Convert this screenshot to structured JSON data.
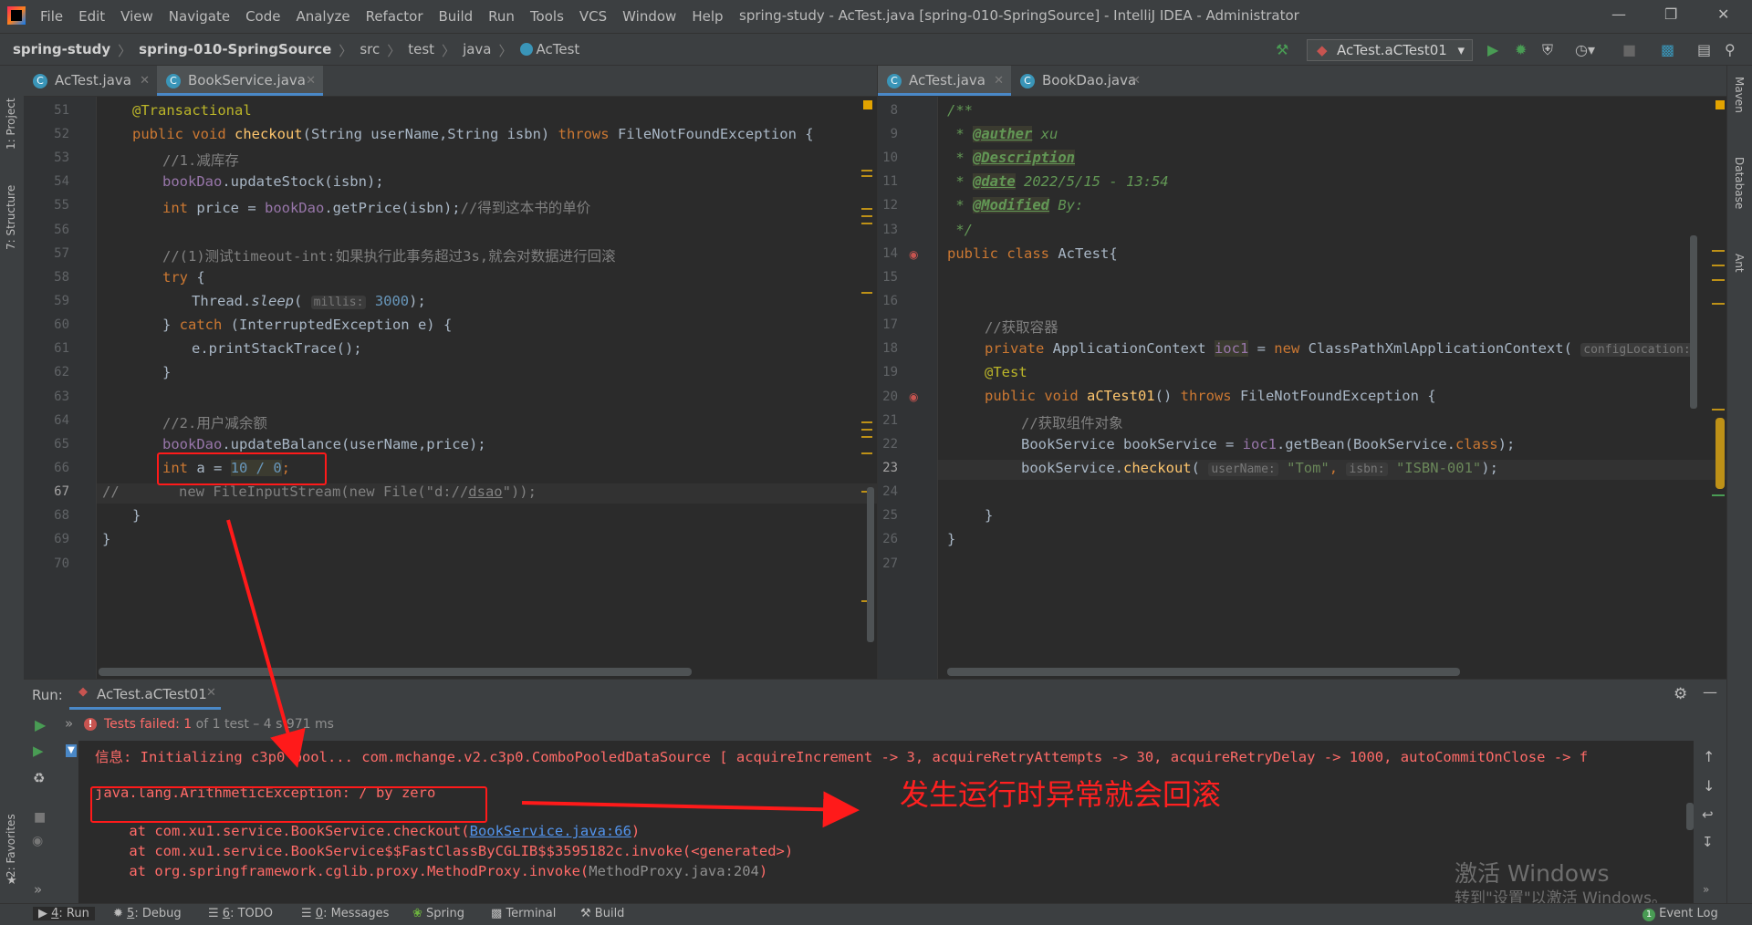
{
  "window": {
    "title": "spring-study - AcTest.java [spring-010-SpringSource] - IntelliJ IDEA - Administrator",
    "menu": [
      "File",
      "Edit",
      "View",
      "Navigate",
      "Code",
      "Analyze",
      "Refactor",
      "Build",
      "Run",
      "Tools",
      "VCS",
      "Window",
      "Help"
    ]
  },
  "breadcrumb": {
    "project": "spring-study",
    "module": "spring-010-SpringSource",
    "src": "src",
    "test": "test",
    "java": "java",
    "cls": "AcTest"
  },
  "run_config": "AcTest.aCTest01",
  "left_strip": {
    "project": "1: Project",
    "structure": "7: Structure",
    "favorites": "2: Favorites"
  },
  "right_strip": {
    "maven": "Maven",
    "database": "Database",
    "ant": "Ant"
  },
  "left_tabs": [
    {
      "label": "AcTest.java",
      "active": false
    },
    {
      "label": "BookService.java",
      "active": true
    }
  ],
  "right_tabs": [
    {
      "label": "AcTest.java",
      "active": true
    },
    {
      "label": "BookDao.java",
      "active": false
    }
  ],
  "left_lines": [
    "51",
    "52",
    "53",
    "54",
    "55",
    "56",
    "57",
    "58",
    "59",
    "60",
    "61",
    "62",
    "63",
    "64",
    "65",
    "66",
    "67",
    "68",
    "69",
    "70"
  ],
  "right_lines": [
    "8",
    "9",
    "10",
    "11",
    "12",
    "13",
    "14",
    "15",
    "16",
    "17",
    "18",
    "19",
    "20",
    "21",
    "22",
    "23",
    "24",
    "25",
    "26",
    "27"
  ],
  "left_code": {
    "l51": "@Transactional",
    "l52a": "public void ",
    "l52b": "checkout",
    "l52c": "(String userName,String isbn) ",
    "l52d": "throws ",
    "l52e": "FileNotFoundException {",
    "l53": "//1.减库存",
    "l54a": "bookDao",
    "l54b": ".updateStock(isbn);",
    "l55a": "int ",
    "l55b": "price = ",
    "l55c": "bookDao",
    "l55d": ".getPrice(isbn);",
    "l55e": "//得到这本书的单价",
    "l57": "//(1)测试timeout-int:如果执行此事务超过3s,就会对数据进行回滚",
    "l58a": "try ",
    "l58b": "{",
    "l59a": "Thread.",
    "l59b": "sleep",
    "l59c": "( ",
    "l59h": "millis:",
    "l59d": "3000",
    "l59e": ");",
    "l60a": "} ",
    "l60b": "catch ",
    "l60c": "(InterruptedException e) {",
    "l61": "e.printStackTrace();",
    "l62": "}",
    "l64": "//2.用户减余额",
    "l65a": "bookDao",
    "l65b": ".updateBalance(userName,price);",
    "l66a": "int ",
    "l66b": "a = ",
    "l66c": "10 / 0",
    "l66d": ";",
    "l67a": "//",
    "l67b": "new FileInputStream(new File(\"d://",
    "l67c": "dsao",
    "l67d": "\"));",
    "l68": "}",
    "l69": "}"
  },
  "right_code": {
    "l8": "/**",
    "l9a": " * ",
    "l9b": "@auther",
    "l9c": " xu",
    "l10a": " * ",
    "l10b": "@Description",
    "l11a": " * ",
    "l11b": "@date",
    "l11c": " 2022/5/15 - 13:54",
    "l12a": " * ",
    "l12b": "@Modified",
    "l12c": " By:",
    "l13": " */",
    "l14a": "public class ",
    "l14b": "AcTest{",
    "l17": "//获取容器",
    "l18a": "private ",
    "l18b": "ApplicationContext ",
    "l18c": "ioc1",
    "l18d": " = ",
    "l18e": "new ",
    "l18f": "ClassPathXmlApplicationContext(",
    "l18g": "configLocation:",
    "l19": "@Test",
    "l20a": "public void ",
    "l20b": "aCTest01",
    "l20c": "() ",
    "l20d": "throws ",
    "l20e": "FileNotFoundException {",
    "l21": "//获取组件对象",
    "l22a": "BookService bookService = ",
    "l22b": "ioc1",
    "l22c": ".getBean(BookService.",
    "l22d": "class",
    "l22e": ");",
    "l23a": "bookService.",
    "l23b": "checkout",
    "l23c": "( ",
    "l23h1": "userName:",
    "l23d": "\"Tom\"",
    "l23e": ", ",
    "l23h2": "isbn:",
    "l23f": "\"ISBN-001\"",
    "l23g": ");",
    "l25": "}",
    "l26": "}"
  },
  "run_panel": {
    "label": "Run:",
    "tab": "AcTest.aCTest01",
    "status_failed": "Tests failed: ",
    "status_count": "1",
    "status_rest": " of 1 test – 4 s 971 ms"
  },
  "console": {
    "line1": "信息: Initializing c3p0 pool... com.mchange.v2.c3p0.ComboPooledDataSource [ acquireIncrement -> 3, acquireRetryAttempts -> 30, acquireRetryDelay -> 1000, autoCommitOnClose -> f",
    "line2": "java.lang.ArithmeticException: / by zero",
    "line3a": "    at com.xu1.service.BookService.checkout(",
    "line3b": "BookService.java:66",
    "line3c": ")",
    "line4": "    at com.xu1.service.BookService$$FastClassByCGLIB$$3595182c.invoke(<generated>)",
    "line5a": "    at org.springframework.cglib.proxy.MethodProxy.invoke(",
    "line5b": "MethodProxy.java:204",
    "line5c": ")"
  },
  "annotation": "发生运行时异常就会回滚",
  "watermark": {
    "line1": "激活 Windows",
    "line2": "转到\"设置\"以激活 Windows。"
  },
  "bottom_tools": {
    "run_num": "4",
    "run": ": Run",
    "debug_num": "5",
    "debug": ": Debug",
    "todo_num": "6",
    "todo": ": TODO",
    "messages_num": "0",
    "messages": ": Messages",
    "spring": "Spring",
    "terminal": "Terminal",
    "build": "Build",
    "event_log": "Event Log",
    "event_count": "1"
  },
  "colors": {
    "accent": "#4a88c7",
    "error": "#ff6b68",
    "annotation_red": "#ff1a1a",
    "run_green": "#499c54"
  }
}
